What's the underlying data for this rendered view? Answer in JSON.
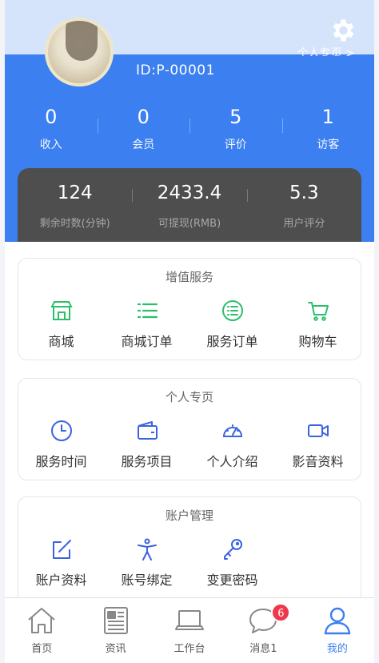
{
  "header": {
    "id_text": "ID:P-00001",
    "profile_link": "个人专页 >"
  },
  "stats": [
    {
      "value": "0",
      "label": "收入"
    },
    {
      "value": "0",
      "label": "会员"
    },
    {
      "value": "5",
      "label": "评价"
    },
    {
      "value": "1",
      "label": "访客"
    }
  ],
  "summary": [
    {
      "value": "124",
      "label": "剩余时数(分钟)"
    },
    {
      "value": "2433.4",
      "label": "可提现(RMB)"
    },
    {
      "value": "5.3",
      "label": "用户评分"
    }
  ],
  "sections": {
    "value_added": {
      "title": "增值服务",
      "items": [
        {
          "label": "商城",
          "icon": "store-icon"
        },
        {
          "label": "商城订单",
          "icon": "list-icon"
        },
        {
          "label": "服务订单",
          "icon": "circle-list-icon"
        },
        {
          "label": "购物车",
          "icon": "cart-icon"
        }
      ]
    },
    "personal": {
      "title": "个人专页",
      "items": [
        {
          "label": "服务时间",
          "icon": "clock-icon"
        },
        {
          "label": "服务项目",
          "icon": "wallet-icon"
        },
        {
          "label": "个人介绍",
          "icon": "gauge-icon"
        },
        {
          "label": "影音资料",
          "icon": "video-icon"
        }
      ]
    },
    "account": {
      "title": "账户管理",
      "items": [
        {
          "label": "账户资料",
          "icon": "edit-icon"
        },
        {
          "label": "账号绑定",
          "icon": "person-icon"
        },
        {
          "label": "变更密码",
          "icon": "key-icon"
        }
      ]
    }
  },
  "nav": {
    "tabs": [
      {
        "label": "首页",
        "icon": "home-icon"
      },
      {
        "label": "资讯",
        "icon": "news-icon"
      },
      {
        "label": "工作台",
        "icon": "laptop-icon"
      },
      {
        "label": "消息1",
        "icon": "chat-icon",
        "badge": "6"
      },
      {
        "label": "我的",
        "icon": "user-icon",
        "active": true
      }
    ]
  },
  "colors": {
    "primary": "#3b7ff0",
    "green": "#2bbf6a",
    "dark_card": "#4e4e4e",
    "badge": "#f0374d"
  }
}
